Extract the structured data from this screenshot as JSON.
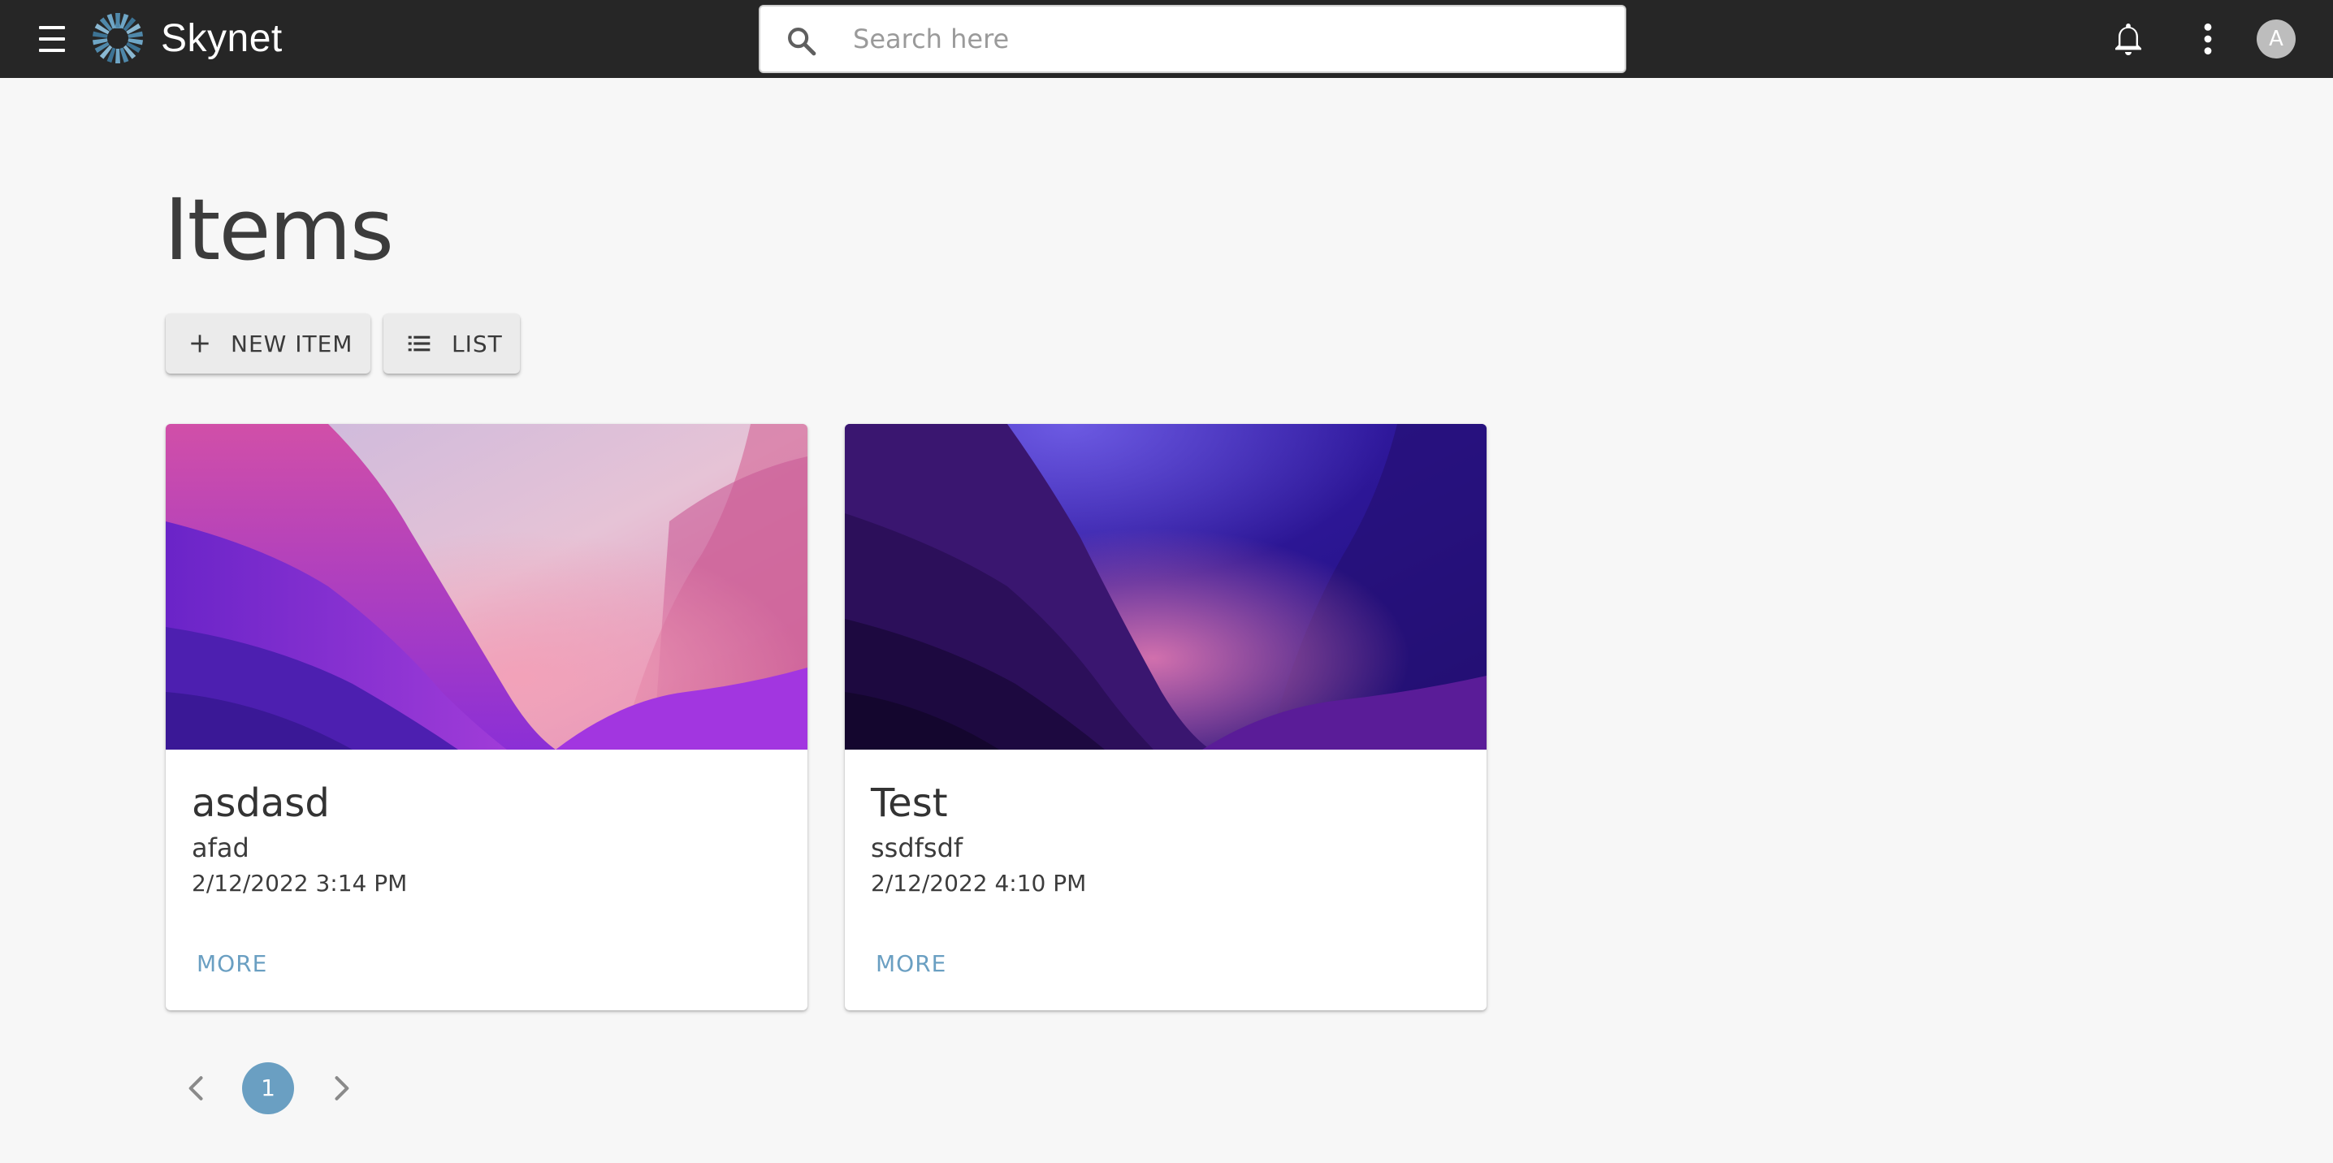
{
  "header": {
    "app_title": "Skynet",
    "search_placeholder": "Search here",
    "search_value": "",
    "avatar_initial": "A",
    "icons": [
      "menu-icon",
      "skynet-logo",
      "search-icon",
      "bell-icon",
      "more-vert-icon"
    ]
  },
  "main": {
    "page_title": "Items",
    "toolbar": {
      "new_item_label": "NEW ITEM",
      "list_label": "LIST"
    },
    "cards": [
      {
        "title": "asdasd",
        "subtitle": "afad",
        "date": "2/12/2022 3:14 PM",
        "action_label": "MORE",
        "image": "pink-violet-mountain-wallpaper"
      },
      {
        "title": "Test",
        "subtitle": "ssdfsdf",
        "date": "2/12/2022 4:10 PM",
        "action_label": "MORE",
        "image": "dark-violet-mountain-wallpaper"
      }
    ]
  },
  "pagination": {
    "current_page": "1"
  },
  "colors": {
    "header_bg": "#262626",
    "page_bg": "#f7f7f7",
    "accent": "#6a9fc2"
  }
}
